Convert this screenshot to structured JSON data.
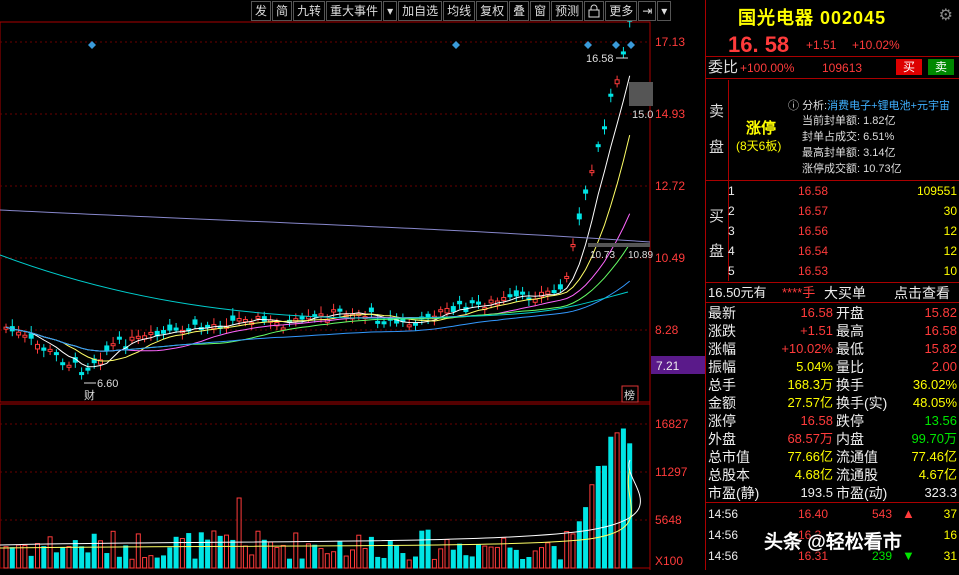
{
  "toolbar": {
    "buttons": [
      "发",
      "简",
      "九转",
      "重大事件",
      "▾",
      "加自选",
      "均线",
      "复权",
      "叠",
      "窗",
      "预测",
      "lock",
      "更多",
      "⇥",
      "▾"
    ]
  },
  "chart": {
    "price_axis": [
      "17.13",
      "14.93",
      "12.72",
      "10.49",
      "8.28"
    ],
    "current_price_tag": "7.21",
    "peak_label": "16.58",
    "peak_tag": "15.0",
    "low_label": "6.60",
    "ma_label": "10.73",
    "ma_label2": "10.89",
    "cai_marker": "财",
    "bang_marker": "榜",
    "volume_axis": [
      "16827",
      "11297",
      "5648"
    ],
    "volume_unit": "X100"
  },
  "stock": {
    "name": "国光电器",
    "code": "002045",
    "price": "16. 58",
    "change": "+1.51",
    "change_pct": "+10.02%",
    "weibi_label": "委比",
    "weibi": "+100.00%",
    "weicha": "109613",
    "sell_btn": "买",
    "buy_btn": "卖"
  },
  "limit": {
    "sell_side": [
      "卖",
      "盘"
    ],
    "status": "涨停",
    "streak": "(8天6板)",
    "analysis_label": "分析:",
    "analysis": "消费电子+锂电池+元宇宙",
    "items": [
      "当前封单额: 1.82亿",
      "封单占成交: 6.51%",
      "最高封单额: 3.14亿",
      "涨停成交额: 10.73亿"
    ]
  },
  "orderbook": {
    "buy_side": [
      "买",
      "盘"
    ],
    "rows": [
      {
        "n": "1",
        "p": "16.58",
        "v": "109551"
      },
      {
        "n": "2",
        "p": "16.57",
        "v": "30"
      },
      {
        "n": "3",
        "p": "16.56",
        "v": "12"
      },
      {
        "n": "4",
        "p": "16.54",
        "v": "12"
      },
      {
        "n": "5",
        "p": "16.53",
        "v": "10"
      }
    ]
  },
  "big_order": {
    "price": "16.50元有",
    "qty": "****手",
    "bigbuy": "大买单",
    "view": "点击查看"
  },
  "stats": [
    [
      "最新",
      "16.58",
      "开盘",
      "15.82"
    ],
    [
      "涨跌",
      "+1.51",
      "最高",
      "16.58"
    ],
    [
      "涨幅",
      "+10.02%",
      "最低",
      "15.82"
    ],
    [
      "振幅",
      "5.04%",
      "量比",
      "2.00"
    ],
    [
      "总手",
      "168.3万",
      "换手",
      "36.02%"
    ],
    [
      "金额",
      "27.57亿",
      "换手(实)",
      "48.05%"
    ],
    [
      "涨停",
      "16.58",
      "跌停",
      "13.56"
    ],
    [
      "外盘",
      "68.57万",
      "内盘",
      "99.70万"
    ],
    [
      "总市值",
      "77.66亿",
      "流通值",
      "77.46亿"
    ],
    [
      "总股本",
      "4.68亿",
      "流通股",
      "4.67亿"
    ],
    [
      "市盈(静)",
      "193.5",
      "市盈(动)",
      "323.3"
    ]
  ],
  "ticks": [
    {
      "t": "14:56",
      "p": "16.40",
      "v": "543",
      "dir": "up",
      "n": "37"
    },
    {
      "t": "14:56",
      "p": "16.3",
      "v": "",
      "dir": "",
      "n": "16"
    },
    {
      "t": "14:56",
      "p": "16.31",
      "v": "239",
      "dir": "down",
      "n": "31"
    }
  ],
  "watermark": "头条 @轻松看市",
  "colors": {
    "up": "#ff3b3b",
    "down": "#00e600",
    "vol_up": "#ff3b3b",
    "vol_down": "#00e5e5",
    "accent": "#ffff00"
  }
}
